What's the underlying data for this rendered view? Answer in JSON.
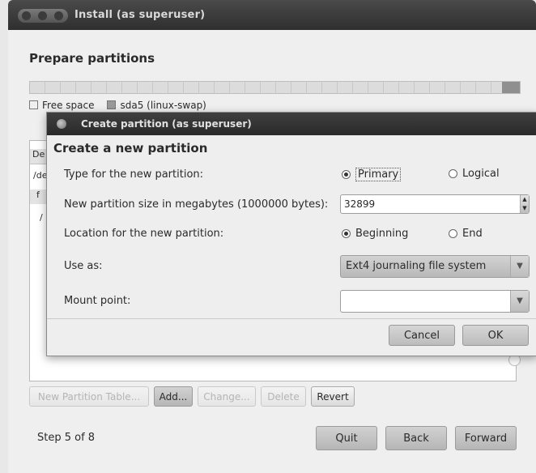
{
  "outer_window": {
    "title": "Install (as superuser)",
    "heading": "Prepare partitions",
    "legend": {
      "free_space": "Free space",
      "swap": "sda5 (linux-swap)"
    },
    "table_fragments": {
      "col_header": "De",
      "row1": "/de",
      "row2": "f",
      "row3": "/"
    },
    "buttons": {
      "new_partition_table": "New Partition Table...",
      "add": "Add...",
      "change": "Change...",
      "delete": "Delete",
      "revert": "Revert"
    },
    "step": "Step 5 of 8",
    "nav": {
      "quit": "Quit",
      "back": "Back",
      "forward": "Forward"
    }
  },
  "dialog": {
    "title": "Create partition (as superuser)",
    "heading": "Create a new partition",
    "type_label": "Type for the new partition:",
    "type_options": {
      "primary": "Primary",
      "logical": "Logical"
    },
    "type_selected": "primary",
    "size_label": "New partition size in megabytes (1000000 bytes):",
    "size_value": "32899",
    "location_label": "Location for the new partition:",
    "location_options": {
      "beginning": "Beginning",
      "end": "End"
    },
    "location_selected": "beginning",
    "use_as_label": "Use as:",
    "use_as_value": "Ext4 journaling file system",
    "mount_label": "Mount point:",
    "mount_value": "",
    "cancel": "Cancel",
    "ok": "OK"
  },
  "icons": {
    "dialog_icon": "disk-icon",
    "combo_arrow": "chevron-down-icon"
  }
}
